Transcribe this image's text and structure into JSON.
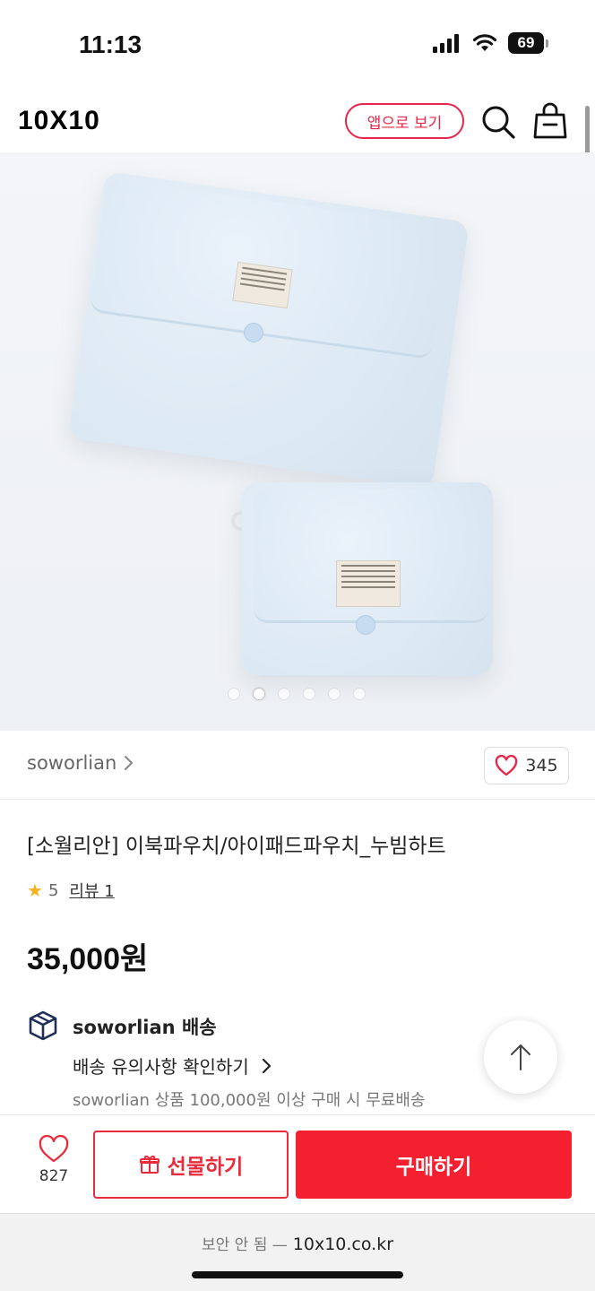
{
  "status_bar": {
    "time": "11:13",
    "battery": "69"
  },
  "header": {
    "logo": "10X10",
    "app_button": "앱으로 보기"
  },
  "gallery": {
    "slide_count": 6,
    "active_index": 1
  },
  "brand": {
    "name": "soworlian",
    "likes": "345"
  },
  "product": {
    "title": "[소월리안] 이북파우치/아이패드파우치_누빔하트",
    "rating": "5",
    "reviews": "리뷰 1",
    "price": "35,000원"
  },
  "shipping": {
    "title": "soworlian 배송",
    "notice": "배송 유의사항 확인하기",
    "free_info": "soworlian 상품 100,000원 이상 구매 시 무료배송"
  },
  "bottom_bar": {
    "wish_count": "827",
    "gift_label": "선물하기",
    "buy_label": "구매하기"
  },
  "browser": {
    "security": "보안 안 됨 —",
    "url": "10x10.co.kr"
  },
  "colors": {
    "accent": "#f5202f",
    "app_button": "#e8264a",
    "star": "#f5b320"
  }
}
